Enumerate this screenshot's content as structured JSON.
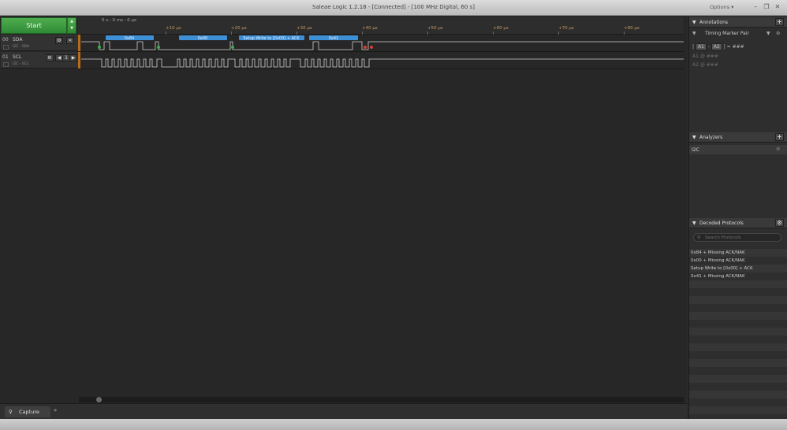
{
  "window": {
    "title": "Saleae Logic 1.2.18 - [Connected] - [100 MHz Digital, 60 s]",
    "options_label": "Options ▾",
    "minimize_icon": "minimize-icon",
    "restore_icon": "restore-icon",
    "close_icon": "close-icon"
  },
  "toolbar": {
    "start_label": "Start",
    "time_origin": "0 s : 0 ms : 0 µs",
    "ticks": [
      "+10 µs",
      "+20 µs",
      "+30 µs",
      "+40 µs",
      "+50 µs",
      "+60 µs",
      "+70 µs",
      "+80 µs"
    ]
  },
  "channels": [
    {
      "number": "00",
      "name": "SDA",
      "sub": "I2C - SDA"
    },
    {
      "number": "01",
      "name": "SCL",
      "sub": "I2C - SCL"
    }
  ],
  "scl_trigger_label": "1",
  "decode_bubbles": [
    "0x84",
    "0x00",
    "Setup Write to [0x00] + ACK",
    "0x41"
  ],
  "annotations": {
    "header": "Annotations",
    "timing_marker": "Timing Marker Pair",
    "a1": "A1",
    "a2": "A2",
    "pair_expr_pre": "|",
    "pair_expr_mid": "-",
    "pair_expr_post": "| = ###",
    "a1_row_label": "A1",
    "a1_row_at": "@",
    "a1_row_value": "###",
    "a2_row_label": "A2",
    "a2_row_at": "@",
    "a2_row_value": "###"
  },
  "analyzers": {
    "header": "Analyzers",
    "items": [
      "I2C"
    ]
  },
  "decoded": {
    "header": "Decoded Protocols",
    "search_placeholder": "Search Protocols",
    "rows": [
      "0x84 + Missing ACK/NAK",
      "0x00 + Missing ACK/NAK",
      "Setup Write to [0x00] + ACK",
      "0x41 + Missing ACK/NAK"
    ]
  },
  "statusbar": {
    "capture_tab": "Capture",
    "more_icon": "double-chevron-icon"
  },
  "colors": {
    "accent_blue": "#3d8fd6",
    "start_green": "#3a9a3f",
    "tick_orange": "#c79a5e",
    "start_marker": "#3fae4a",
    "stop_marker": "#d8403a"
  }
}
